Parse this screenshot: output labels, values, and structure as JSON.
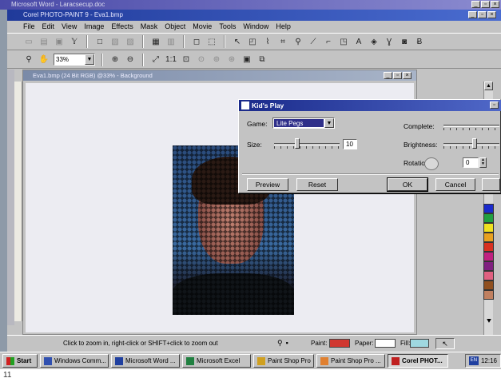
{
  "word_window": {
    "title": "Microsoft Word - Laracsecup.doc"
  },
  "corel_window": {
    "title": "Corel PHOTO-PAINT 9 - Eva1.bmp",
    "menu": [
      "File",
      "Edit",
      "View",
      "Image",
      "Effects",
      "Mask",
      "Object",
      "Movie",
      "Tools",
      "Window",
      "Help"
    ],
    "zoom": "33%"
  },
  "image_window": {
    "title": "Eva1.bmp (24 Bit RGB) @33% - Background"
  },
  "dialog": {
    "title": "Kid's Play",
    "game_label": "Game:",
    "game_value": "Lite Pegs",
    "size_label": "Size:",
    "size_value": "10",
    "complete_label": "Complete:",
    "brightness_label": "Brightness:",
    "rotation_label": "Rotation:",
    "rotation_value": "0",
    "buttons": {
      "preview": "Preview",
      "reset": "Reset",
      "ok": "OK",
      "cancel": "Cancel"
    }
  },
  "statusbar": {
    "hint": "Click to zoom in, right-click or SHIFT+click to zoom out",
    "paint_label": "Paint:",
    "paper_label": "Paper:",
    "fill_label": "Fill:",
    "paint_color": "#d03830",
    "paper_color": "#ffffff",
    "fill_color": "#9fd8e0"
  },
  "palette_colors": [
    "#1a2acc",
    "#20a040",
    "#f0e020",
    "#e8a020",
    "#d83020",
    "#c02080",
    "#802080",
    "#e06080",
    "#905020",
    "#c08060"
  ],
  "taskbar": {
    "start": "Start",
    "tasks": [
      "Windows Comm...",
      "Microsoft Word ...",
      "Microsoft Excel",
      "Paint Shop Pro",
      "Paint Shop Pro ...",
      "Corel PHOT..."
    ],
    "clock": "12:16"
  },
  "caption": "11"
}
